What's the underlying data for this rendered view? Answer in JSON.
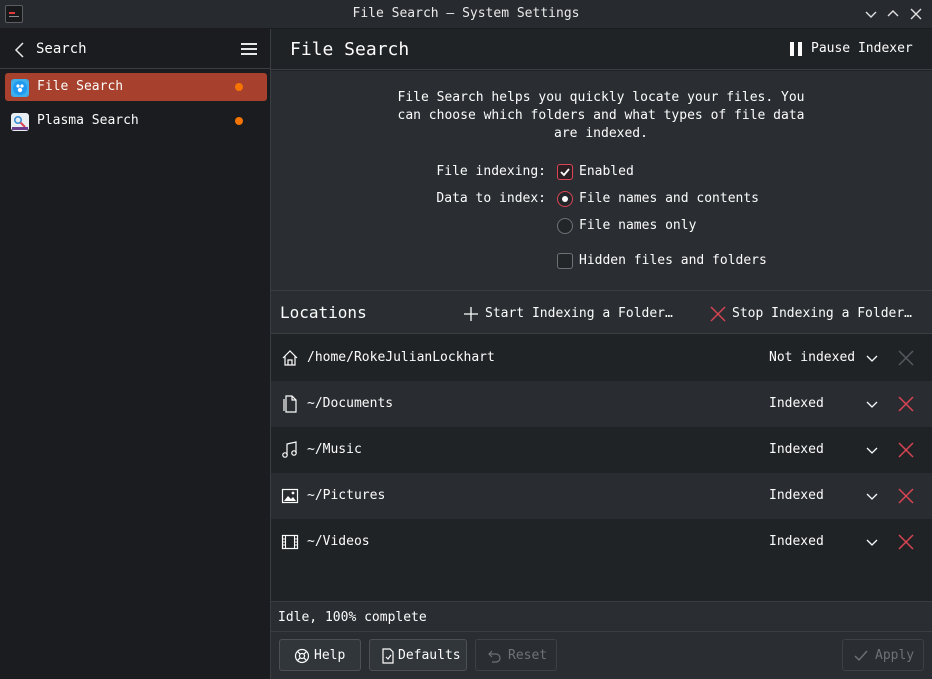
{
  "window": {
    "title": "File Search — System Settings"
  },
  "sidebar": {
    "back_label": "Search",
    "items": [
      {
        "label": "File Search",
        "active": true,
        "modified": true,
        "icon": "baloo-icon"
      },
      {
        "label": "Plasma Search",
        "active": false,
        "modified": true,
        "icon": "krunner-icon"
      }
    ]
  },
  "header": {
    "title": "File Search",
    "pause_label": "Pause Indexer"
  },
  "settings": {
    "description_lines": [
      "File Search helps you quickly locate your files. You",
      "can choose which folders and what types of file data",
      "are indexed."
    ],
    "file_indexing_label": "File indexing:",
    "enabled_label": "Enabled",
    "enabled_checked": true,
    "data_to_index_label": "Data to index:",
    "option_names_contents": "File names and contents",
    "option_names_only": "File names only",
    "selected_option": "File names and contents",
    "hidden_label": "Hidden files and folders",
    "hidden_checked": false
  },
  "locations": {
    "title": "Locations",
    "start_label": "Start Indexing a Folder…",
    "stop_label": "Stop Indexing a Folder…",
    "rows": [
      {
        "path": "/home/RokeJulianLockhart",
        "status": "Not indexed",
        "icon": "home-icon",
        "removable": false
      },
      {
        "path": "~/Documents",
        "status": "Indexed",
        "icon": "documents-icon",
        "removable": true
      },
      {
        "path": "~/Music",
        "status": "Indexed",
        "icon": "music-icon",
        "removable": true
      },
      {
        "path": "~/Pictures",
        "status": "Indexed",
        "icon": "pictures-icon",
        "removable": true
      },
      {
        "path": "~/Videos",
        "status": "Indexed",
        "icon": "videos-icon",
        "removable": true
      }
    ]
  },
  "status": {
    "text": "Idle, 100% complete"
  },
  "footer": {
    "help_label": "Help",
    "defaults_label": "Defaults",
    "reset_label": "Reset",
    "apply_label": "Apply"
  },
  "colors": {
    "accent": "#a7402c",
    "remove": "#da4453",
    "modified_dot": "#f67400"
  }
}
